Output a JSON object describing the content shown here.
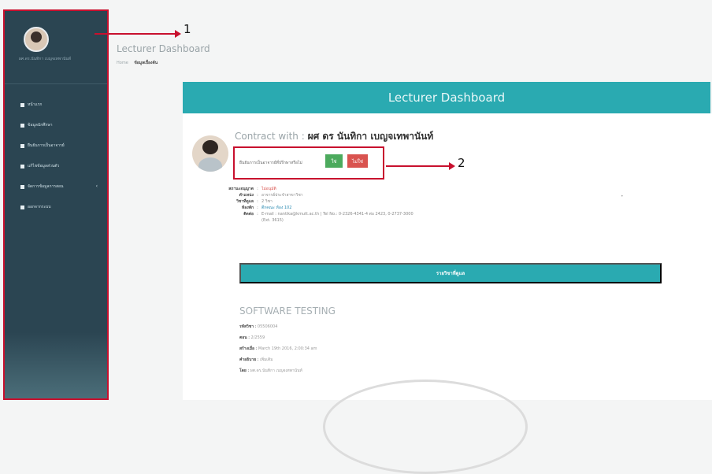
{
  "sidebar": {
    "user_name": "ผศ.ดร.นันทิกา เบญจเทพานันท์",
    "items": [
      {
        "label": "หน้าแรก",
        "icon": "grid-icon"
      },
      {
        "label": "ข้อมูลนักศึกษา",
        "icon": "grid-icon"
      },
      {
        "label": "ยืนยันการเป็นอาจารย์",
        "icon": "grid-icon"
      },
      {
        "label": "แก้ไขข้อมูลส่วนตัว",
        "icon": "grid-icon"
      },
      {
        "label": "จัดการข้อมูลการสอน",
        "icon": "grid-icon",
        "has_submenu": true
      },
      {
        "label": "ออกจากระบบ",
        "icon": "grid-icon"
      }
    ]
  },
  "annotations": {
    "one": "1",
    "two": "2"
  },
  "header": {
    "title": "Lecturer Dashboard",
    "breadcrumb_home": "Home",
    "breadcrumb_current": "ข้อมูลเบื้องต้น"
  },
  "banner": {
    "title": "Lecturer Dashboard"
  },
  "profile": {
    "contract_label": "Contract with :",
    "name": "ผศ ดร นันทิกา เบญจเทพานันท์"
  },
  "confirm": {
    "question": "ยืนยันการเป็นอาจารย์ที่ปรึกษาหรือไม่",
    "yes": "ใช่",
    "no": "ไม่ใช่"
  },
  "info": {
    "status_label": "สถานะอนุญาต",
    "status_value": "ไม่อนุมัติ",
    "position_label": "ตำแหน่ง",
    "position_value": "อาจารย์ประจำสาขาวิชา",
    "subjects_label": "วิชาที่ดูแล",
    "subjects_value": "2 วิชา",
    "room_label": "ห้องพัก",
    "room_value": "ตึกคณะ ห้อง 102",
    "contact_label": "ติดต่อ",
    "contact_value": "E-mail : nantika@kmutt.ac.th | Tel No.: 0-2326-4341-4 ต่อ 2423, 0-2737-3000",
    "contact_extra": "(Ext. 3615)"
  },
  "subjects_button": "รายวิชาที่ดูแล",
  "course": {
    "title": "SOFTWARE TESTING",
    "code_label": "รหัสวิชา",
    "code_value": "05506004",
    "section_label": "ตอน",
    "section_value": "2/2559",
    "created_label": "สร้างเมื่อ",
    "created_value": "March 19th 2016, 2:00:34 am",
    "desc_label": "คำอธิบาย",
    "desc_value": "เพิ่มเติม",
    "by_label": "โดย",
    "by_value": "ผศ.ดร.นันทิกา เบญจเทพานันท์"
  },
  "colors": {
    "sidebar": "#2b4552",
    "accent": "#2aaab1",
    "annotation": "#c8102e",
    "yes": "#4caa5d",
    "no": "#d9534f"
  }
}
